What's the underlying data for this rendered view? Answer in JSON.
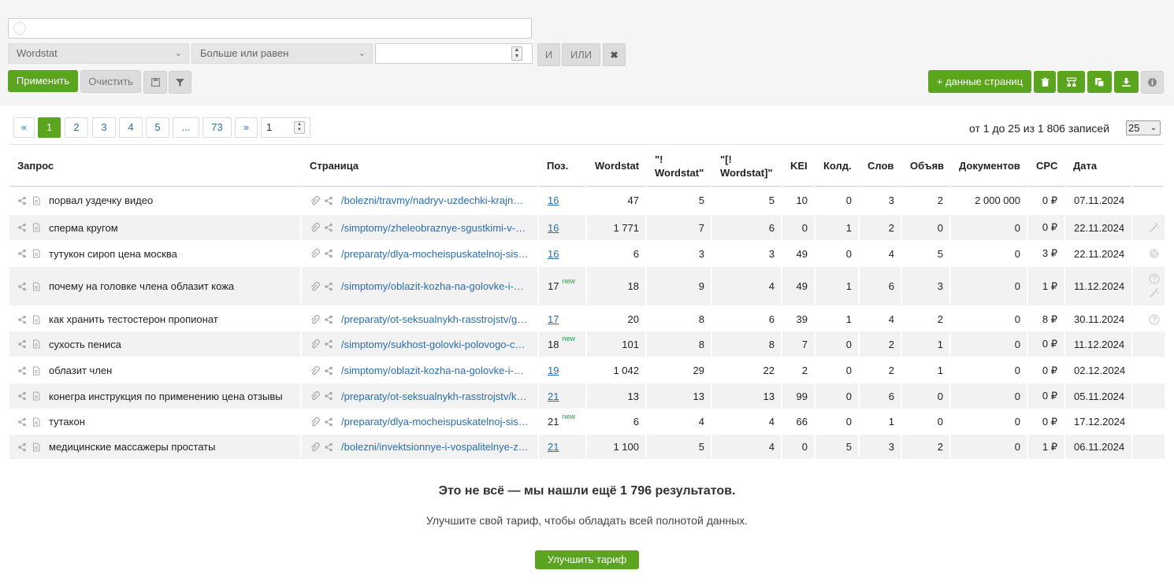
{
  "search": {
    "placeholder": ""
  },
  "filter": {
    "field_select": "Wordstat",
    "operator_select": "Больше или равен",
    "value": "",
    "and_label": "И",
    "or_label": "ИЛИ",
    "apply_label": "Применить",
    "clear_label": "Очистить"
  },
  "toolbar": {
    "page_data_label": "+ данные страниц"
  },
  "pagination": {
    "prev": "«",
    "pages": [
      "1",
      "2",
      "3",
      "4",
      "5",
      "...",
      "73"
    ],
    "next": "»",
    "page_input": "1",
    "records": "от 1 до 25 из 1 806 записей",
    "per_page": "25"
  },
  "table": {
    "headers": {
      "query": "Запрос",
      "page": "Страница",
      "pos": "Поз.",
      "wordstat": "Wordstat",
      "ws_quoted_1": "\"!",
      "ws_quoted_2": "Wordstat\"",
      "ws_exact_1": "\"[!",
      "ws_exact_2": "Wordstat]\"",
      "kei": "KEI",
      "competitors": "Колд.",
      "words": "Слов",
      "ads": "Объяв",
      "documents": "Документов",
      "cpc": "CPC",
      "date": "Дата"
    },
    "rows": [
      {
        "query": "порвал уздечку видео",
        "page": "/bolezni/travmy/nadryv-uzdechki-krajnei-ploti/",
        "pos": "16",
        "pos_new": "",
        "wordstat": "47",
        "ws_quoted": "5",
        "ws_exact": "5",
        "kei": "10",
        "competitors": "0",
        "words": "3",
        "ads": "2",
        "documents": "2 000 000",
        "cpc": "0 ₽",
        "date": "07.11.2024",
        "action": ""
      },
      {
        "query": "сперма кругом",
        "page": "/simptomy/zheleobraznye-sgustkimi-v-sperme/",
        "pos": "16",
        "pos_new": "",
        "wordstat": "1 771",
        "ws_quoted": "7",
        "ws_exact": "6",
        "kei": "0",
        "competitors": "1",
        "words": "2",
        "ads": "0",
        "documents": "0",
        "cpc": "0 ₽",
        "date": "22.11.2024",
        "action": "wand"
      },
      {
        "query": "тутукон сироп цена москва",
        "page": "/preparaty/dlya-mocheispuskatelnoj-sistemy/",
        "pos": "16",
        "pos_new": "",
        "wordstat": "6",
        "ws_quoted": "3",
        "ws_exact": "3",
        "kei": "49",
        "competitors": "0",
        "words": "4",
        "ads": "5",
        "documents": "0",
        "cpc": "3 ₽",
        "date": "22.11.2024",
        "action": "globe"
      },
      {
        "query": "почему на головке члена облазит кожа",
        "page": "/simptomy/oblazit-kozha-na-golovke-i-krajnei-ploti/",
        "pos": "17",
        "pos_new": "new",
        "wordstat": "18",
        "ws_quoted": "9",
        "ws_exact": "4",
        "kei": "49",
        "competitors": "1",
        "words": "6",
        "ads": "3",
        "documents": "0",
        "cpc": "1 ₽",
        "date": "11.12.2024",
        "action": "help-wand"
      },
      {
        "query": "как хранить тестостерон пропионат",
        "page": "/preparaty/ot-seksualnykh-rasstrojstv/gormonalnye/",
        "pos": "17",
        "pos_new": "",
        "wordstat": "20",
        "ws_quoted": "8",
        "ws_exact": "6",
        "kei": "39",
        "competitors": "1",
        "words": "4",
        "ads": "2",
        "documents": "0",
        "cpc": "8 ₽",
        "date": "30.11.2024",
        "action": "help"
      },
      {
        "query": "сухость пениса",
        "page": "/simptomy/sukhost-golovki-polovogo-chlena/",
        "pos": "18",
        "pos_new": "new",
        "wordstat": "101",
        "ws_quoted": "8",
        "ws_exact": "8",
        "kei": "7",
        "competitors": "0",
        "words": "2",
        "ads": "1",
        "documents": "0",
        "cpc": "0 ₽",
        "date": "11.12.2024",
        "action": ""
      },
      {
        "query": "облазит член",
        "page": "/simptomy/oblazit-kozha-na-golovke-i-krajnei-ploti/",
        "pos": "19",
        "pos_new": "",
        "wordstat": "1 042",
        "ws_quoted": "29",
        "ws_exact": "22",
        "kei": "2",
        "competitors": "0",
        "words": "2",
        "ads": "1",
        "documents": "0",
        "cpc": "0 ₽",
        "date": "02.12.2024",
        "action": ""
      },
      {
        "query": "конегра инструкция по применению цена отзывы",
        "page": "/preparaty/ot-seksualnykh-rasstrojstv/konegra/",
        "pos": "21",
        "pos_new": "",
        "wordstat": "13",
        "ws_quoted": "13",
        "ws_exact": "13",
        "kei": "99",
        "competitors": "0",
        "words": "6",
        "ads": "0",
        "documents": "0",
        "cpc": "0 ₽",
        "date": "05.11.2024",
        "action": ""
      },
      {
        "query": "тутакон",
        "page": "/preparaty/dlya-mocheispuskatelnoj-sistemy/",
        "pos": "21",
        "pos_new": "new",
        "wordstat": "6",
        "ws_quoted": "4",
        "ws_exact": "4",
        "kei": "66",
        "competitors": "0",
        "words": "1",
        "ads": "0",
        "documents": "0",
        "cpc": "0 ₽",
        "date": "17.12.2024",
        "action": ""
      },
      {
        "query": "медицинские массажеры простаты",
        "page": "/bolezni/invektsionnye-i-vospalitelnye-zabolevaniya/",
        "pos": "21",
        "pos_new": "",
        "wordstat": "1 100",
        "ws_quoted": "5",
        "ws_exact": "4",
        "kei": "0",
        "competitors": "5",
        "words": "3",
        "ads": "2",
        "documents": "0",
        "cpc": "1 ₽",
        "date": "06.11.2024",
        "action": ""
      }
    ]
  },
  "cta": {
    "title": "Это не всё — мы нашли ещё 1 796 результатов.",
    "subtitle": "Улучшите свой тариф, чтобы обладать всей полнотой данных.",
    "button": "Улучшить тариф"
  },
  "colors": {
    "accent": "#5aa51d",
    "link": "#2a6db0",
    "new_badge": "#1aa64a",
    "row_alt": "#f2f2f2"
  }
}
